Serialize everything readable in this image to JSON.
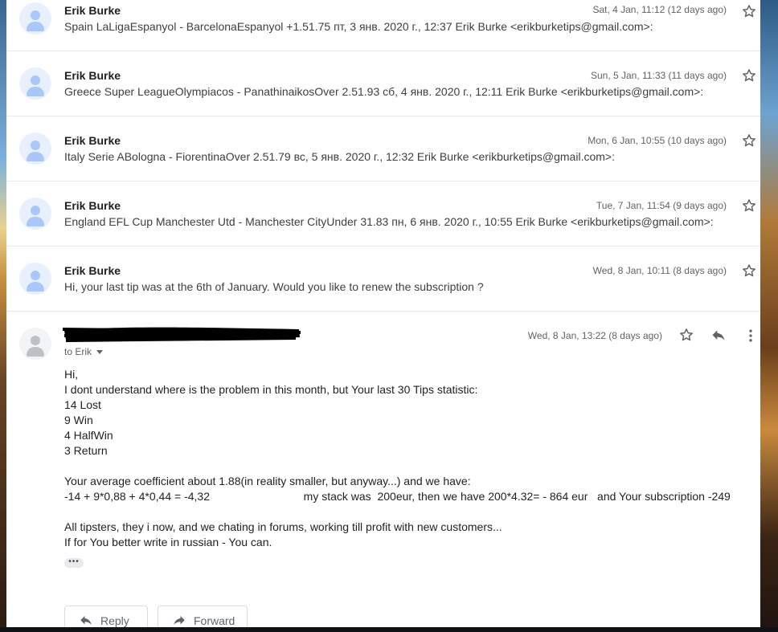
{
  "rows": [
    {
      "sender": "Erik Burke",
      "snippet": "Spain LaLigaEspanyol - BarcelonaEspanyol +1.51.75 пт, 3 янв. 2020 г., 12:37 Erik Burke <erikburketips@gmail.com>:",
      "date": "Sat, 4 Jan, 11:12 (12 days ago)"
    },
    {
      "sender": "Erik Burke",
      "snippet": "Greece Super LeagueOlympiacos - PanathinaikosOver 2.51.93 сб, 4 янв. 2020 г., 12:11 Erik Burke <erikburketips@gmail.com>:",
      "date": "Sun, 5 Jan, 11:33 (11 days ago)"
    },
    {
      "sender": "Erik Burke",
      "snippet": "Italy Serie ABologna - FiorentinaOver 2.51.79 вс, 5 янв. 2020 г., 12:32 Erik Burke <erikburketips@gmail.com>:",
      "date": "Mon, 6 Jan, 10:55 (10 days ago)"
    },
    {
      "sender": "Erik Burke",
      "snippet": "England EFL Cup Manchester Utd - Manchester CityUnder 31.83 пн, 6 янв. 2020 г., 10:55 Erik Burke <erikburketips@gmail.com>:",
      "date": "Tue, 7 Jan, 11:54 (9 days ago)"
    },
    {
      "sender": "Erik Burke",
      "snippet": "Hi, your last tip was at the 6th of January. Would you like to renew the subscription ?",
      "date": "Wed, 8 Jan, 10:11 (8 days ago)"
    }
  ],
  "open_message": {
    "date": "Wed, 8 Jan, 13:22 (8 days ago)",
    "to": "to Erik",
    "lines": [
      "Hi,",
      "I dont understand where is the problem in this month, but Your last 30 Tips statistic:",
      "14 Lost",
      "9 Win",
      "4 HalfWin",
      "3 Return",
      "",
      "Your average coefficient about 1.88(in reality smaller, but anyway...) and we have:",
      "-14 + 9*0,88 + 4*0,44 = -4,32                              my stack was  200eur, then we have 200*4.32= - 864 eur   and Your subscription -249",
      "",
      "All tipsters, they i now, and we chating in forums, working till profit with new customers...",
      "If for You better write in russian - You can."
    ],
    "ellipsis": "•••"
  },
  "actions": {
    "reply": "Reply",
    "forward": "Forward"
  },
  "icons": {
    "star": "star-icon",
    "reply": "reply-icon",
    "more": "more-vert-icon",
    "forward": "forward-icon"
  },
  "colors": {
    "avatar_bg": "#e8f0fe",
    "avatar_fg": "#a8c7fa",
    "muted": "#5f6368"
  }
}
